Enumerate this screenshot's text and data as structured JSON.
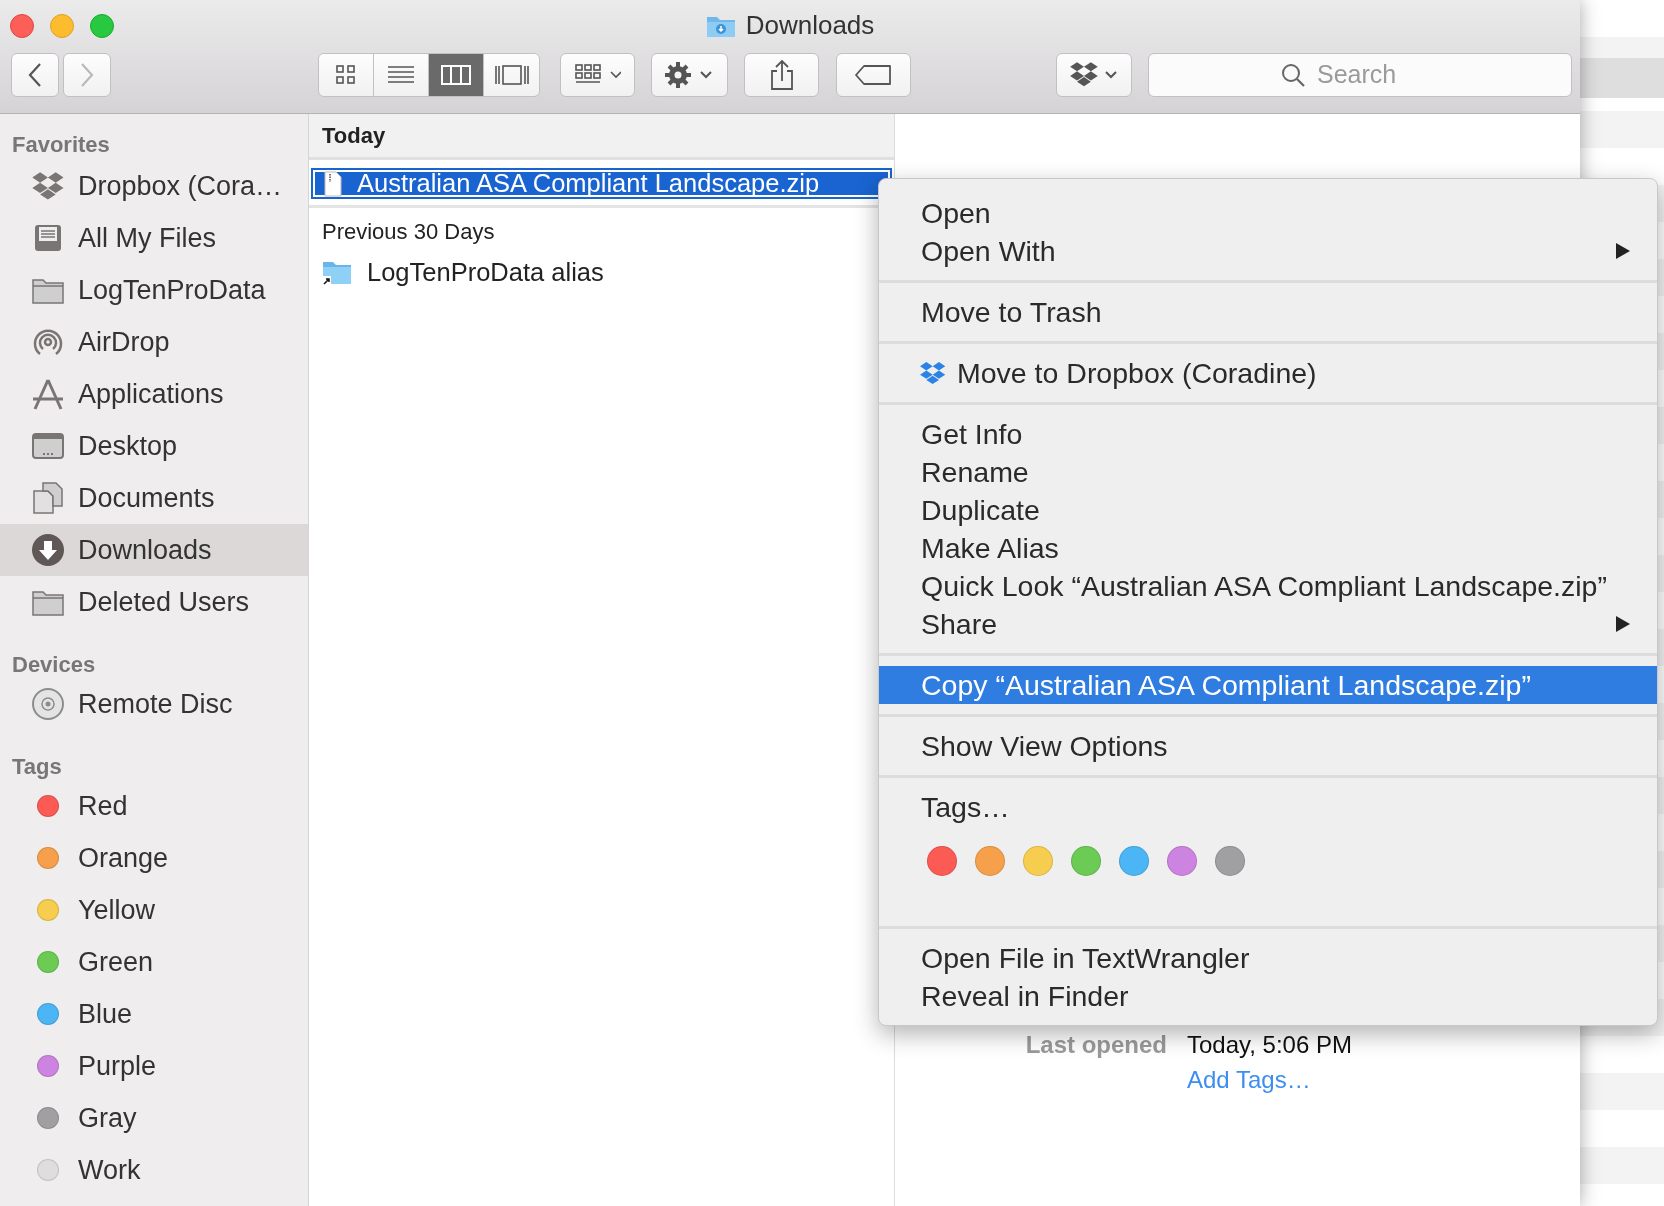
{
  "window": {
    "title": "Downloads"
  },
  "toolbar": {
    "nav": [
      {
        "kind": "back",
        "disabled": false
      },
      {
        "kind": "forward",
        "disabled": true
      }
    ],
    "view_modes": [
      {
        "kind": "icons",
        "selected": false
      },
      {
        "kind": "list",
        "selected": false
      },
      {
        "kind": "columns",
        "selected": true
      },
      {
        "kind": "gallery",
        "selected": false
      }
    ],
    "buttons": [
      {
        "kind": "arrange"
      },
      {
        "kind": "action"
      },
      {
        "kind": "share"
      },
      {
        "kind": "tags"
      },
      {
        "kind": "dropbox"
      }
    ],
    "search": {
      "placeholder": "Search"
    }
  },
  "sidebar": {
    "sections": [
      {
        "title": "Favorites",
        "items": [
          {
            "label": "Dropbox (Cora…",
            "kind": "dropbox",
            "selected": false
          },
          {
            "label": "All My Files",
            "kind": "files",
            "selected": false
          },
          {
            "label": "LogTenProData",
            "kind": "folder",
            "selected": false
          },
          {
            "label": "AirDrop",
            "kind": "airdrop",
            "selected": false
          },
          {
            "label": "Applications",
            "kind": "apps",
            "selected": false
          },
          {
            "label": "Desktop",
            "kind": "desktop",
            "selected": false
          },
          {
            "label": "Documents",
            "kind": "documents",
            "selected": false
          },
          {
            "label": "Downloads",
            "kind": "downloads",
            "selected": true
          },
          {
            "label": "Deleted Users",
            "kind": "folder",
            "selected": false
          }
        ]
      },
      {
        "title": "Devices",
        "items": [
          {
            "label": "Remote Disc",
            "kind": "disc",
            "selected": false
          }
        ]
      },
      {
        "title": "Tags",
        "items": [
          {
            "label": "Red",
            "kind": "tag",
            "color": "#fc5a55",
            "selected": false
          },
          {
            "label": "Orange",
            "kind": "tag",
            "color": "#f6a04b",
            "selected": false
          },
          {
            "label": "Yellow",
            "kind": "tag",
            "color": "#f6cd4f",
            "selected": false
          },
          {
            "label": "Green",
            "kind": "tag",
            "color": "#6bcb55",
            "selected": false
          },
          {
            "label": "Blue",
            "kind": "tag",
            "color": "#4cb5f5",
            "selected": false
          },
          {
            "label": "Purple",
            "kind": "tag",
            "color": "#cc84e0",
            "selected": false
          },
          {
            "label": "Gray",
            "kind": "tag",
            "color": "#a0a0a2",
            "selected": false
          },
          {
            "label": "Work",
            "kind": "tag",
            "color": "#dedede",
            "selected": false
          }
        ]
      }
    ]
  },
  "column": {
    "groups": [
      {
        "title": "Today",
        "files": [
          {
            "name": "Australian ASA Compliant Landscape.zip",
            "kind": "zip",
            "selected": true
          }
        ]
      },
      {
        "title": "Previous 30 Days",
        "files": [
          {
            "name": "LogTenProData alias",
            "kind": "alias",
            "selected": false
          }
        ]
      }
    ]
  },
  "preview": {
    "rows": [
      {
        "label": "Last opened",
        "value": "Today, 5:06 PM"
      }
    ],
    "add_tags": "Add Tags…"
  },
  "context_menu": {
    "groups": [
      {
        "items": [
          {
            "label": "Open",
            "kind": "plain",
            "submenu": false,
            "selected": false
          },
          {
            "label": "Open With",
            "kind": "plain",
            "submenu": true,
            "selected": false
          }
        ]
      },
      {
        "items": [
          {
            "label": "Move to Trash",
            "kind": "plain",
            "submenu": false,
            "selected": false
          }
        ]
      },
      {
        "items": [
          {
            "label": "Move to Dropbox (Coradine)",
            "kind": "dropbox",
            "submenu": false,
            "selected": false
          }
        ]
      },
      {
        "items": [
          {
            "label": "Get Info",
            "kind": "plain",
            "submenu": false,
            "selected": false
          },
          {
            "label": "Rename",
            "kind": "plain",
            "submenu": false,
            "selected": false
          },
          {
            "label": "Duplicate",
            "kind": "plain",
            "submenu": false,
            "selected": false
          },
          {
            "label": "Make Alias",
            "kind": "plain",
            "submenu": false,
            "selected": false
          },
          {
            "label": "Quick Look “Australian ASA Compliant Landscape.zip”",
            "kind": "plain",
            "submenu": false,
            "selected": false
          },
          {
            "label": "Share",
            "kind": "plain",
            "submenu": true,
            "selected": false
          }
        ]
      },
      {
        "items": [
          {
            "label": "Copy “Australian ASA Compliant Landscape.zip”",
            "kind": "plain",
            "submenu": false,
            "selected": true
          }
        ]
      },
      {
        "items": [
          {
            "label": "Show View Options",
            "kind": "plain",
            "submenu": false,
            "selected": false
          }
        ]
      },
      {
        "items": [
          {
            "label": "Tags…",
            "kind": "plain",
            "submenu": false,
            "selected": false
          }
        ],
        "colors": [
          {
            "color": "#fc5a55"
          },
          {
            "color": "#f6a04b"
          },
          {
            "color": "#f6cd4f"
          },
          {
            "color": "#6bcb55"
          },
          {
            "color": "#4cb5f5"
          },
          {
            "color": "#cc84e0"
          },
          {
            "color": "#a0a0a2"
          }
        ]
      },
      {
        "items": [
          {
            "label": "Open File in TextWrangler",
            "kind": "plain",
            "submenu": false,
            "selected": false
          },
          {
            "label": "Reveal in Finder",
            "kind": "plain",
            "submenu": false,
            "selected": false
          }
        ]
      }
    ]
  }
}
